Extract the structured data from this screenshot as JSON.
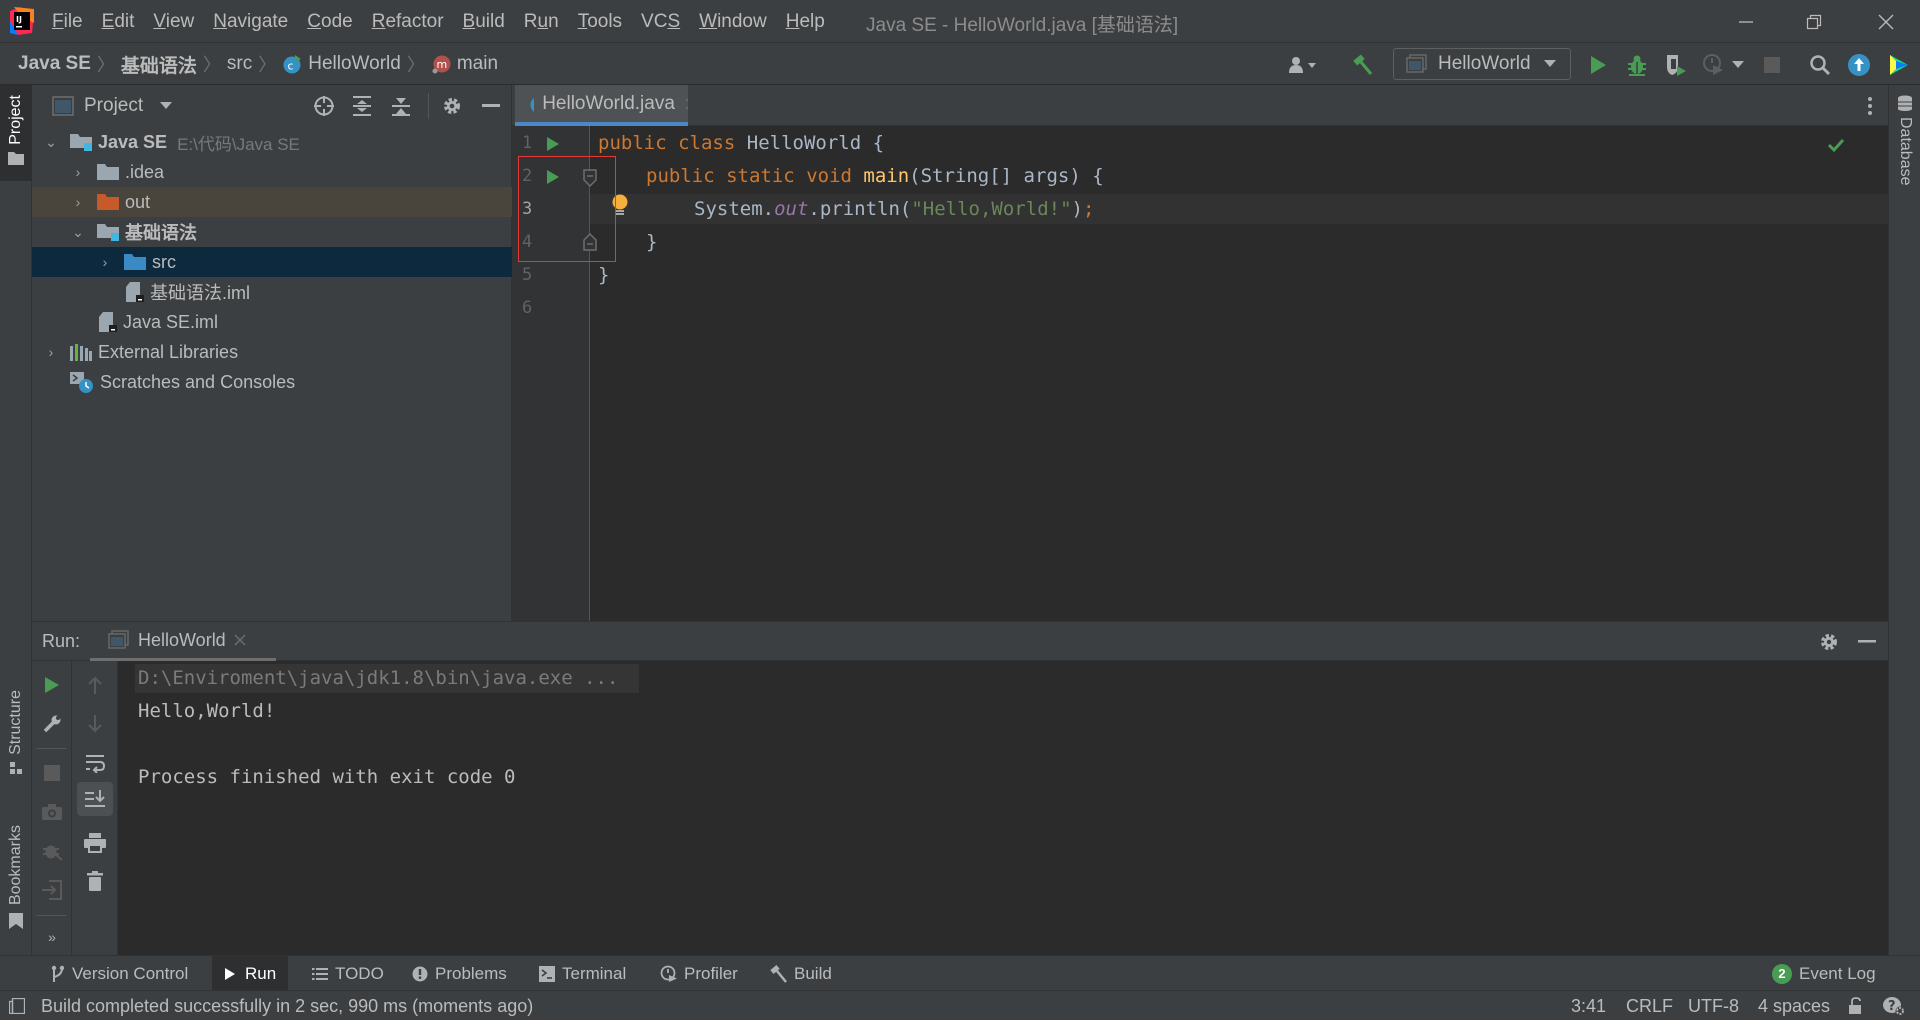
{
  "window": {
    "title": "Java SE - HelloWorld.java [基础语法]",
    "controls": {
      "minimize": "minimize-icon",
      "restore": "restore-icon",
      "close": "close-icon"
    }
  },
  "menu": {
    "items": [
      {
        "mnemonic": "F",
        "rest": "ile"
      },
      {
        "mnemonic": "E",
        "rest": "dit"
      },
      {
        "mnemonic": "V",
        "rest": "iew"
      },
      {
        "mnemonic": "N",
        "rest": "avigate"
      },
      {
        "mnemonic": "C",
        "rest": "ode"
      },
      {
        "mnemonic": "R",
        "rest": "efactor"
      },
      {
        "mnemonic": "B",
        "rest": "uild"
      },
      {
        "pre": "R",
        "mnemonic": "u",
        "rest": "n"
      },
      {
        "mnemonic": "T",
        "rest": "ools"
      },
      {
        "pre": "VC",
        "mnemonic": "S",
        "rest": ""
      },
      {
        "mnemonic": "W",
        "rest": "indow"
      },
      {
        "mnemonic": "H",
        "rest": "elp"
      }
    ]
  },
  "breadcrumb": {
    "items": [
      "Java SE",
      "基础语法",
      "src",
      "HelloWorld",
      "main"
    ]
  },
  "toolbar": {
    "run_config": "HelloWorld",
    "colors": {
      "run": "#499c54",
      "accent": "#3592c4"
    }
  },
  "left_stripe": {
    "project": "Project",
    "structure": "Structure",
    "bookmarks": "Bookmarks"
  },
  "right_stripe": {
    "database": "Database"
  },
  "project_panel": {
    "title": "Project",
    "tree": [
      {
        "label": "Java SE",
        "hint": "E:\\代码\\Java SE",
        "bold": true,
        "expanded": true
      },
      {
        "label": ".idea",
        "expanded": false
      },
      {
        "label": "out",
        "expanded": false
      },
      {
        "label": "基础语法",
        "bold": true,
        "expanded": true
      },
      {
        "label": "src",
        "expanded": false,
        "selected": true
      },
      {
        "label": "基础语法.iml"
      },
      {
        "label": "Java SE.iml"
      },
      {
        "label": "External Libraries",
        "expanded": false
      },
      {
        "label": "Scratches and Consoles"
      }
    ]
  },
  "editor": {
    "tab": "HelloWorld.java",
    "line_numbers": [
      "1",
      "2",
      "3",
      "4",
      "5",
      "6"
    ],
    "code": {
      "l1": {
        "kw1": "public",
        "kw2": "class",
        "name": "HelloWorld",
        "brace": " {"
      },
      "l2": {
        "kw1": "public",
        "kw2": "static",
        "kw3": "void",
        "fn": "main",
        "rest": "(String[] args) {"
      },
      "l3": {
        "pre": "System.",
        "field": "out",
        "mid": ".println(",
        "str": "\"Hello,World!\"",
        "close": ")",
        "semi": ";"
      },
      "l4": "}",
      "l5": "}"
    }
  },
  "run_panel": {
    "label": "Run:",
    "tab": "HelloWorld",
    "console": {
      "command": "D:\\Enviroment\\java\\jdk1.8\\bin\\java.exe ...",
      "output": "Hello,World!",
      "exit": "Process finished with exit code 0"
    }
  },
  "bottom_tools": {
    "items": [
      "Version Control",
      "Run",
      "TODO",
      "Problems",
      "Terminal",
      "Profiler",
      "Build"
    ],
    "event_log": "Event Log",
    "event_count": "2"
  },
  "status": {
    "message": "Build completed successfully in 2 sec, 990 ms (moments ago)",
    "position": "3:41",
    "line_sep": "CRLF",
    "encoding": "UTF-8",
    "indent": "4 spaces"
  }
}
